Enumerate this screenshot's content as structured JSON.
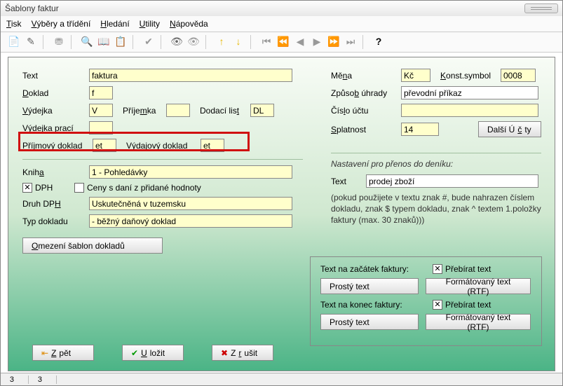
{
  "title": "Šablony faktur",
  "menu": {
    "tisk": "Tisk",
    "vybery": "Výběry a třídění",
    "hledani": "Hledání",
    "utility": "Utility",
    "napoveda": "Nápověda"
  },
  "left": {
    "text_label": "Text",
    "text_val": "faktura",
    "doklad_label": "Doklad",
    "doklad_val": "f",
    "vydejka_label": "Výdejka",
    "vydejka_val": "V",
    "prijemka_label": "Příjemka",
    "prijemka_val": "",
    "dodaci_label": "Dodací list",
    "dodaci_val": "DL",
    "vydejka_praci_label": "Výdejka prací",
    "vydejka_praci_val": "",
    "prijmovy_label": "Příjmový doklad",
    "prijmovy_val": "et",
    "vydajovy_label": "Výdajový doklad",
    "vydajovy_val": "et",
    "kniha_label": "Kniha",
    "kniha_val": "1 - Pohledávky",
    "dph_label": "DPH",
    "ceny_label": "Ceny s daní z přidané hodnoty",
    "druh_label": "Druh DPH",
    "druh_val": "Uskutečněná v tuzemsku",
    "typ_label": "Typ dokladu",
    "typ_val": "- běžný daňový doklad",
    "omezeni_btn": "Omezení šablon dokladů"
  },
  "right": {
    "mena_label": "Měna",
    "mena_val": "Kč",
    "ks_label": "Konst.symbol",
    "ks_val": "0008",
    "zpusob_label": "Způsob úhrady",
    "zpusob_val": "převodní příkaz",
    "cislo_label": "Číslo účtu",
    "cislo_val": "",
    "splatnost_label": "Splatnost",
    "splatnost_val": "14",
    "dalsi_btn": "Další Účty",
    "nastaveni": "Nastavení pro přenos do deníku:",
    "text_label": "Text",
    "text_val": "prodej zboží",
    "hint": "(pokud použijete v textu znak #, bude nahrazen číslem dokladu, znak $ typem dokladu, znak ^ textem 1.položky faktury (max. 30 znaků)))"
  },
  "box": {
    "zacatek": "Text na začátek faktury:",
    "konec": "Text na konec faktury:",
    "prebirat": "Přebírat text",
    "prosty": "Prostý text",
    "rtf": "Formátovaný text (RTF)"
  },
  "buttons": {
    "zpet": "Zpět",
    "ulozit": "Uložit",
    "zrusit": "Zrušit"
  },
  "status": {
    "a": "3",
    "b": "3"
  }
}
